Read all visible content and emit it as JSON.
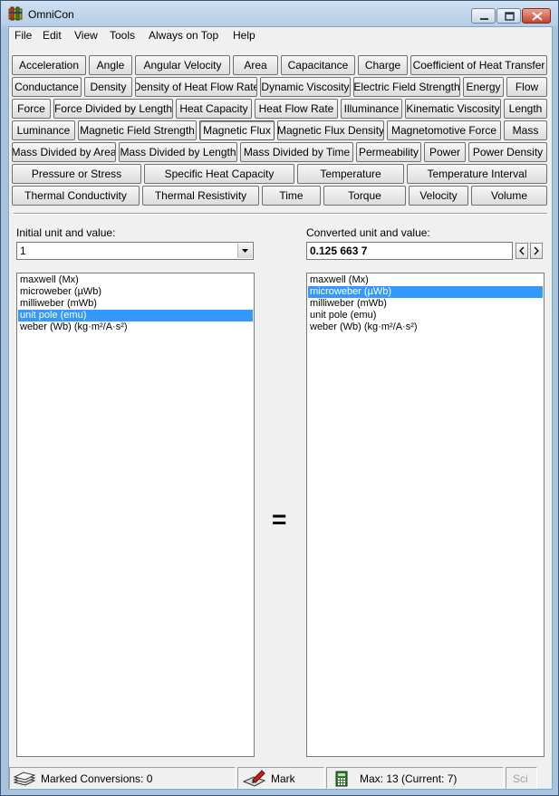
{
  "window": {
    "title": "OmniCon"
  },
  "menu": [
    "File",
    "Edit",
    "View",
    "Tools",
    "Always on Top",
    "Help"
  ],
  "categories": [
    [
      "Acceleration",
      "Angle",
      "Angular Velocity",
      "Area",
      "Capacitance",
      "Charge",
      "Coefficient of Heat Transfer"
    ],
    [
      "Conductance",
      "Density",
      "Density of Heat Flow Rate",
      "Dynamic Viscosity",
      "Electric Field Strength",
      "Energy",
      "Flow"
    ],
    [
      "Force",
      "Force Divided by Length",
      "Heat Capacity",
      "Heat Flow Rate",
      "Illuminance",
      "Kinematic Viscosity",
      "Length"
    ],
    [
      "Luminance",
      "Magnetic Field Strength",
      "Magnetic Flux",
      "Magnetic Flux Density",
      "Magnetomotive Force",
      "Mass"
    ],
    [
      "Mass Divided by Area",
      "Mass Divided by Length",
      "Mass Divided by Time",
      "Permeability",
      "Power",
      "Power Density"
    ],
    [
      "Pressure or Stress",
      "Specific Heat Capacity",
      "Temperature",
      "Temperature Interval"
    ],
    [
      "Thermal Conductivity",
      "Thermal Resistivity",
      "Time",
      "Torque",
      "Velocity",
      "Volume"
    ]
  ],
  "active_category": "Magnetic Flux",
  "initial": {
    "label": "Initial unit and value:",
    "value": "1",
    "units": [
      "maxwell (Mx)",
      "microweber (µWb)",
      "milliweber (mWb)",
      "unit pole (emu)",
      "weber (Wb) (kg·m²/A·s²)"
    ],
    "selected_index": 3
  },
  "converted": {
    "label": "Converted unit and value:",
    "value": "0.125 663 7",
    "units": [
      "maxwell (Mx)",
      "microweber (µWb)",
      "milliweber (mWb)",
      "unit pole (emu)",
      "weber (Wb) (kg·m²/A·s²)"
    ],
    "selected_index": 1
  },
  "equals_sign": "=",
  "status": {
    "marked": "Marked Conversions: 0",
    "mark": "Mark",
    "max": "Max: 13 (Current: 7)",
    "sci": "Sci"
  },
  "icons": {
    "app": "omnicon-app-icon",
    "marked": "stack-icon",
    "mark": "mark-pen-icon",
    "calculator": "calculator-icon"
  }
}
